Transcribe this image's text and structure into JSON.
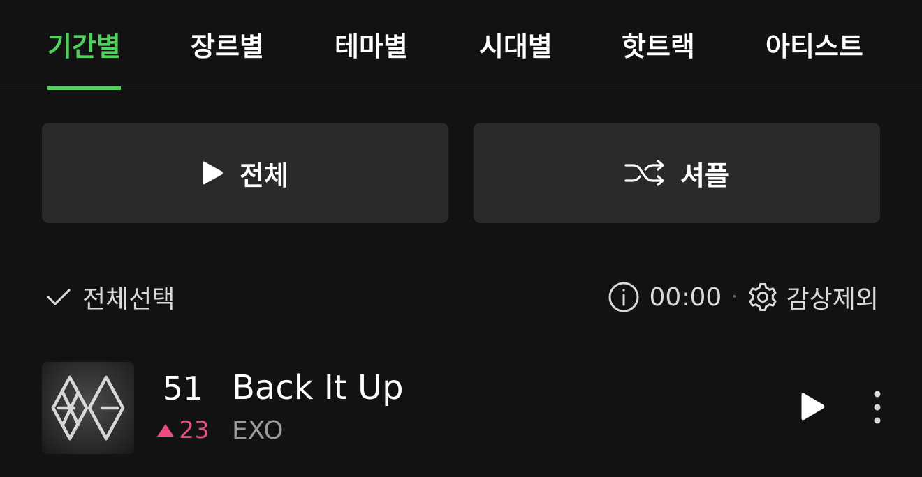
{
  "tabs": [
    {
      "label": "기간별",
      "active": true
    },
    {
      "label": "장르별",
      "active": false
    },
    {
      "label": "테마별",
      "active": false
    },
    {
      "label": "시대별",
      "active": false
    },
    {
      "label": "핫트랙",
      "active": false
    },
    {
      "label": "아티스트",
      "active": false
    }
  ],
  "buttons": {
    "play_all_label": "전체",
    "shuffle_label": "셔플"
  },
  "toolbar": {
    "select_all_label": "전체선택",
    "duration": "00:00",
    "separator": "·",
    "exclude_label": "감상제외"
  },
  "track": {
    "rank": "51",
    "rank_change": "23",
    "rank_direction": "up",
    "title": "Back It Up",
    "artist": "EXO",
    "album_art": "exo-logo-album-cover"
  },
  "colors": {
    "accent": "#4fd15c",
    "rank_up": "#ec4a83",
    "background": "#121212",
    "button_bg": "#2a2a2a",
    "secondary_text": "#9a9a9a"
  },
  "icons": {
    "play_all": "play-icon",
    "shuffle": "shuffle-icon",
    "select_all": "check-icon",
    "info": "info-icon",
    "settings": "gear-icon",
    "row_play": "play-icon",
    "more": "more-vertical-icon",
    "rank_up": "triangle-up-icon"
  }
}
